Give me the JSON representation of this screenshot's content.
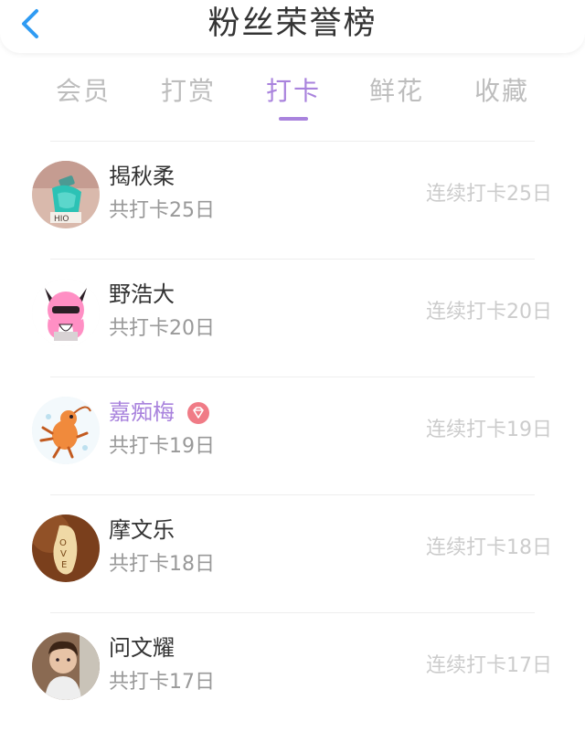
{
  "header": {
    "title": "粉丝荣誉榜",
    "back_icon": "chevron-left-icon",
    "accent_color": "#2f9bf3"
  },
  "tabs": [
    {
      "label": "会员",
      "active": false
    },
    {
      "label": "打赏",
      "active": false
    },
    {
      "label": "打卡",
      "active": true
    },
    {
      "label": "鲜花",
      "active": false
    },
    {
      "label": "收藏",
      "active": false
    }
  ],
  "active_color": "#a983dd",
  "fans": [
    {
      "name": "揭秋柔",
      "total": "共打卡25日",
      "streak": "连续打卡25日",
      "highlight": false,
      "badge": false
    },
    {
      "name": "野浩大",
      "total": "共打卡20日",
      "streak": "连续打卡20日",
      "highlight": false,
      "badge": false
    },
    {
      "name": "嘉痴梅",
      "total": "共打卡19日",
      "streak": "连续打卡19日",
      "highlight": true,
      "badge": true,
      "badge_icon": "diamond-icon",
      "badge_color": "#f07b86"
    },
    {
      "name": "摩文乐",
      "total": "共打卡18日",
      "streak": "连续打卡18日",
      "highlight": false,
      "badge": false
    },
    {
      "name": "问文耀",
      "total": "共打卡17日",
      "streak": "连续打卡17日",
      "highlight": false,
      "badge": false
    }
  ]
}
